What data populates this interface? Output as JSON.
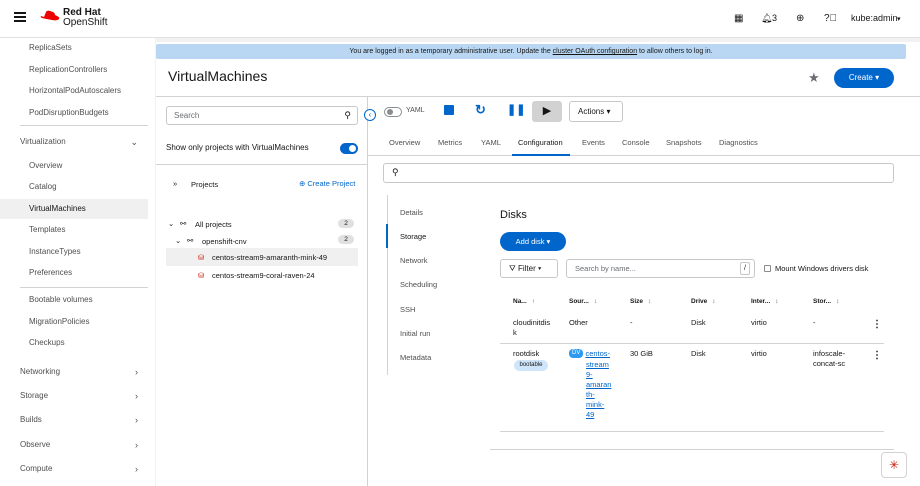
{
  "brand": {
    "line1": "Red Hat",
    "line2": "OpenShift"
  },
  "topbar": {
    "notif_count": "3",
    "user": "kube:admin",
    "user_caret": "▾"
  },
  "sidebar": {
    "items_top": [
      "ReplicaSets",
      "ReplicationControllers",
      "HorizontalPodAutoscalers",
      "PodDisruptionBudgets"
    ],
    "virt_section": "Virtualization",
    "virt_items": [
      "Overview",
      "Catalog",
      "VirtualMachines",
      "Templates",
      "InstanceTypes",
      "Preferences"
    ],
    "virt_items2": [
      "Bootable volumes",
      "MigrationPolicies",
      "Checkups"
    ],
    "sections": [
      "Networking",
      "Storage",
      "Builds",
      "Observe",
      "Compute"
    ]
  },
  "banner": {
    "before": "You are logged in as a temporary administrative user. Update the ",
    "link": "cluster OAuth configuration",
    "after": " to allow others to log in."
  },
  "page": {
    "title": "VirtualMachines",
    "create": "Create"
  },
  "tree": {
    "search_placeholder": "Search",
    "toggle_label": "Show only projects with VirtualMachines",
    "projects_label": "Projects",
    "create_project": "Create Project",
    "all_projects": "All projects",
    "all_count": "2",
    "ns": "openshift-cnv",
    "ns_count": "2",
    "vm1": "centos-stream9-amaranth-mink-49",
    "vm2": "centos-stream9-coral-raven-24"
  },
  "toolbar": {
    "yaml": "YAML",
    "actions": "Actions"
  },
  "tabs": [
    "Overview",
    "Metrics",
    "YAML",
    "Configuration",
    "Events",
    "Console",
    "Snapshots",
    "Diagnostics"
  ],
  "vtabs": [
    "Details",
    "Storage",
    "Network",
    "Scheduling",
    "SSH",
    "Initial run",
    "Metadata"
  ],
  "disks": {
    "title": "Disks",
    "add": "Add disk",
    "filter": "Filter",
    "search_placeholder": "Search by name...",
    "slash": "/",
    "mount_label": "Mount Windows drivers disk",
    "headers": [
      "Na...",
      "Sour...",
      "Size",
      "Drive",
      "Inter...",
      "Stor..."
    ],
    "row1": {
      "name_a": "cloudinitdis",
      "name_b": "k",
      "source": "Other",
      "size": "-",
      "drive": "Disk",
      "iface": "virtio",
      "storage": "-"
    },
    "row2": {
      "name": "rootdisk",
      "badge": "bootable",
      "dv": "DV",
      "src1": "centos-",
      "src2": "stream",
      "src3": "9-",
      "src4": "amaran",
      "src5": "th-",
      "src6": "mink-",
      "src7": "49",
      "size": "30 GiB",
      "drive": "Disk",
      "iface": "virtio",
      "stor1": "infoscale-",
      "stor2": "concat-sc"
    }
  }
}
